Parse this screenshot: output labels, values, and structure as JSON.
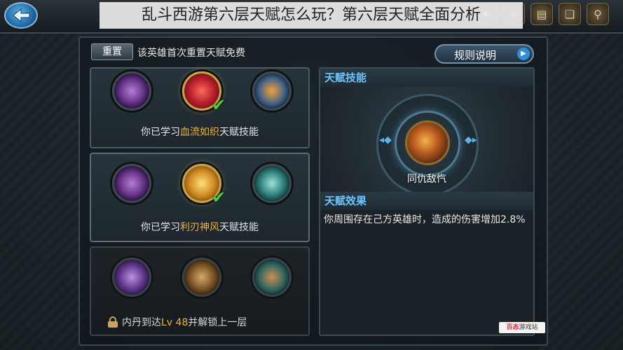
{
  "article_title": "乱斗西游第六层天赋怎么玩？第六层天赋全面分析",
  "top_icons": [
    "toolbar-icon-1",
    "toolbar-icon-2",
    "scroll-icon",
    "book-icon",
    "magnifier-icon"
  ],
  "reset": {
    "button_label": "重置",
    "note": "该英雄首次重置天赋免费"
  },
  "rules_button": {
    "label": "规则说明",
    "arrow": "▶"
  },
  "rows": [
    {
      "learned_prefix": "你已学习",
      "learned_skill": "血流如织",
      "learned_suffix": "天赋技能",
      "icons": [
        "purple-sword-skill-icon",
        "red-armor-skill-icon",
        "gold-warrior-skill-icon"
      ],
      "selected_index": 1
    },
    {
      "learned_prefix": "你已学习",
      "learned_skill": "利刃神风",
      "learned_suffix": "天赋技能",
      "icons": [
        "purple-sword-skill-icon",
        "golden-blade-skill-icon",
        "teal-wind-skill-icon"
      ],
      "selected_index": 1
    },
    {
      "lock_prefix": "内丹到达",
      "lock_level": "Lv 48",
      "lock_suffix": "并解锁上一层",
      "icons": [
        "purple-slash-skill-icon",
        "spear-strike-skill-icon",
        "teal-fighter-skill-icon"
      ]
    }
  ],
  "right": {
    "skill_section_title": "天赋技能",
    "current_skill_name": "同仇敌忾",
    "effect_section_title": "天赋效果",
    "effect_text": "你周围存在己方英雄时，造成的伤害增加2.8%"
  },
  "watermark": {
    "text_a": "百态",
    "text_b": "游戏站"
  }
}
